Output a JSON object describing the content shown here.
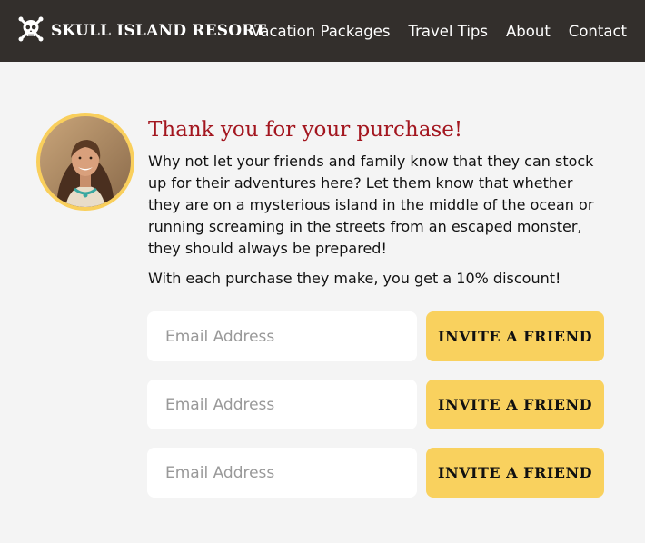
{
  "navbar": {
    "brand": "SKULL ISLAND RESORT",
    "brand_icon": "skull-crossbones-icon",
    "links": [
      "Vacation Packages",
      "Travel Tips",
      "About",
      "Contact"
    ]
  },
  "main": {
    "heading": "Thank you for your purchase!",
    "paragraph1": "Why not let your friends and family know that they can stock up for their adventures here? Let them know that whether they are on a mysterious island in the middle of the ocean or running screaming in the streets from an escaped monster, they should always be prepared!",
    "paragraph2": "With each purchase they make, you get a 10% discount!"
  },
  "invite_forms": [
    {
      "placeholder": "Email Address",
      "value": "",
      "button_label": "INVITE A FRIEND"
    },
    {
      "placeholder": "Email Address",
      "value": "",
      "button_label": "INVITE A FRIEND"
    },
    {
      "placeholder": "Email Address",
      "value": "",
      "button_label": "INVITE A FRIEND"
    }
  ],
  "colors": {
    "navbar_bg": "#332f2c",
    "heading": "#a3161f",
    "button_bg": "#f9d15e",
    "avatar_border": "#f9cf5c",
    "page_bg": "#f4f4f4"
  }
}
